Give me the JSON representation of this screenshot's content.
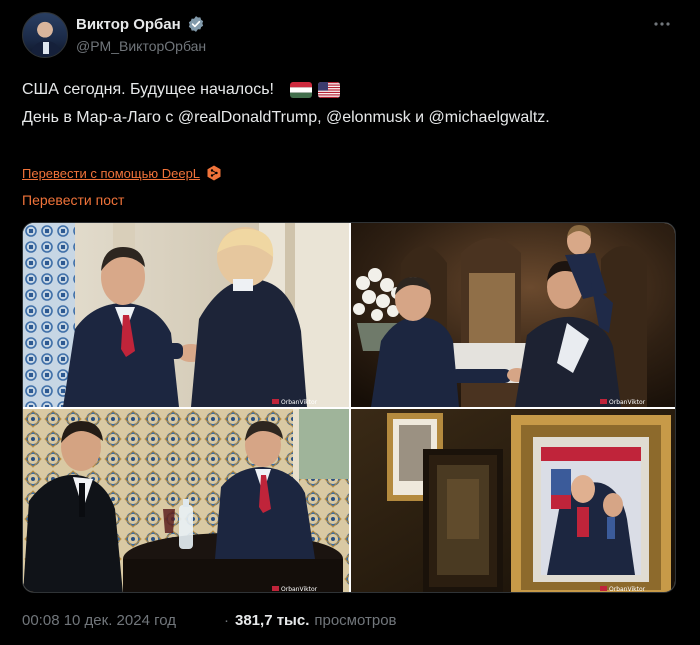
{
  "author": {
    "display_name": "Виктор Орбан",
    "handle": "@PM_ВикторОрбан"
  },
  "post": {
    "line1": "США сегодня. Будущее началось!",
    "line2_prefix": "День в Мар-а-Лаго с ",
    "mention1": "@realDonaldTrump",
    "comma": ", ",
    "mention2": "@elonmusk",
    "and": " и ",
    "mention3": "@michaelgwaltz",
    "period": ".",
    "flags": [
      "hungary-flag",
      "usa-flag"
    ]
  },
  "translate": {
    "deepl_label": "Перевести с помощью DeepL",
    "post_label": "Перевести пост"
  },
  "media": {
    "photos": [
      {
        "name": "handshake-photo"
      },
      {
        "name": "greeting-photo"
      },
      {
        "name": "table-meeting-photo"
      },
      {
        "name": "framed-cover-photo"
      }
    ],
    "watermark": "OrbanViktor"
  },
  "footer": {
    "time": "00:08 10 дек. 2024 год",
    "dot": "·",
    "views_count": "381,7 тыс.",
    "views_label": "просмотров"
  },
  "colors": {
    "background": "#000000",
    "text": "#e7e9ea",
    "muted": "#71767b",
    "translate_accent": "#f0733a"
  }
}
